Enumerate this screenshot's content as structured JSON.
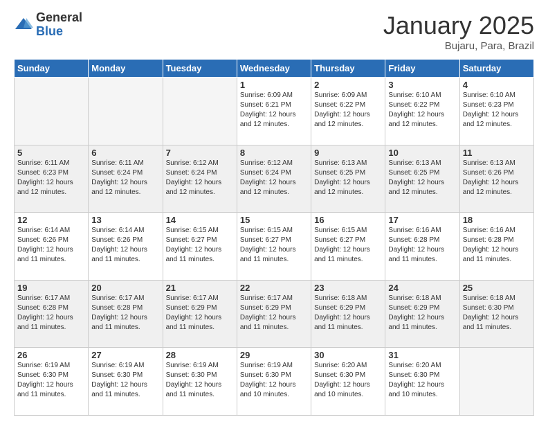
{
  "logo": {
    "general": "General",
    "blue": "Blue"
  },
  "title": "January 2025",
  "subtitle": "Bujaru, Para, Brazil",
  "days_of_week": [
    "Sunday",
    "Monday",
    "Tuesday",
    "Wednesday",
    "Thursday",
    "Friday",
    "Saturday"
  ],
  "weeks": [
    [
      {
        "day": "",
        "info": ""
      },
      {
        "day": "",
        "info": ""
      },
      {
        "day": "",
        "info": ""
      },
      {
        "day": "1",
        "info": "Sunrise: 6:09 AM\nSunset: 6:21 PM\nDaylight: 12 hours\nand 12 minutes."
      },
      {
        "day": "2",
        "info": "Sunrise: 6:09 AM\nSunset: 6:22 PM\nDaylight: 12 hours\nand 12 minutes."
      },
      {
        "day": "3",
        "info": "Sunrise: 6:10 AM\nSunset: 6:22 PM\nDaylight: 12 hours\nand 12 minutes."
      },
      {
        "day": "4",
        "info": "Sunrise: 6:10 AM\nSunset: 6:23 PM\nDaylight: 12 hours\nand 12 minutes."
      }
    ],
    [
      {
        "day": "5",
        "info": "Sunrise: 6:11 AM\nSunset: 6:23 PM\nDaylight: 12 hours\nand 12 minutes."
      },
      {
        "day": "6",
        "info": "Sunrise: 6:11 AM\nSunset: 6:24 PM\nDaylight: 12 hours\nand 12 minutes."
      },
      {
        "day": "7",
        "info": "Sunrise: 6:12 AM\nSunset: 6:24 PM\nDaylight: 12 hours\nand 12 minutes."
      },
      {
        "day": "8",
        "info": "Sunrise: 6:12 AM\nSunset: 6:24 PM\nDaylight: 12 hours\nand 12 minutes."
      },
      {
        "day": "9",
        "info": "Sunrise: 6:13 AM\nSunset: 6:25 PM\nDaylight: 12 hours\nand 12 minutes."
      },
      {
        "day": "10",
        "info": "Sunrise: 6:13 AM\nSunset: 6:25 PM\nDaylight: 12 hours\nand 12 minutes."
      },
      {
        "day": "11",
        "info": "Sunrise: 6:13 AM\nSunset: 6:26 PM\nDaylight: 12 hours\nand 12 minutes."
      }
    ],
    [
      {
        "day": "12",
        "info": "Sunrise: 6:14 AM\nSunset: 6:26 PM\nDaylight: 12 hours\nand 11 minutes."
      },
      {
        "day": "13",
        "info": "Sunrise: 6:14 AM\nSunset: 6:26 PM\nDaylight: 12 hours\nand 11 minutes."
      },
      {
        "day": "14",
        "info": "Sunrise: 6:15 AM\nSunset: 6:27 PM\nDaylight: 12 hours\nand 11 minutes."
      },
      {
        "day": "15",
        "info": "Sunrise: 6:15 AM\nSunset: 6:27 PM\nDaylight: 12 hours\nand 11 minutes."
      },
      {
        "day": "16",
        "info": "Sunrise: 6:15 AM\nSunset: 6:27 PM\nDaylight: 12 hours\nand 11 minutes."
      },
      {
        "day": "17",
        "info": "Sunrise: 6:16 AM\nSunset: 6:28 PM\nDaylight: 12 hours\nand 11 minutes."
      },
      {
        "day": "18",
        "info": "Sunrise: 6:16 AM\nSunset: 6:28 PM\nDaylight: 12 hours\nand 11 minutes."
      }
    ],
    [
      {
        "day": "19",
        "info": "Sunrise: 6:17 AM\nSunset: 6:28 PM\nDaylight: 12 hours\nand 11 minutes."
      },
      {
        "day": "20",
        "info": "Sunrise: 6:17 AM\nSunset: 6:28 PM\nDaylight: 12 hours\nand 11 minutes."
      },
      {
        "day": "21",
        "info": "Sunrise: 6:17 AM\nSunset: 6:29 PM\nDaylight: 12 hours\nand 11 minutes."
      },
      {
        "day": "22",
        "info": "Sunrise: 6:17 AM\nSunset: 6:29 PM\nDaylight: 12 hours\nand 11 minutes."
      },
      {
        "day": "23",
        "info": "Sunrise: 6:18 AM\nSunset: 6:29 PM\nDaylight: 12 hours\nand 11 minutes."
      },
      {
        "day": "24",
        "info": "Sunrise: 6:18 AM\nSunset: 6:29 PM\nDaylight: 12 hours\nand 11 minutes."
      },
      {
        "day": "25",
        "info": "Sunrise: 6:18 AM\nSunset: 6:30 PM\nDaylight: 12 hours\nand 11 minutes."
      }
    ],
    [
      {
        "day": "26",
        "info": "Sunrise: 6:19 AM\nSunset: 6:30 PM\nDaylight: 12 hours\nand 11 minutes."
      },
      {
        "day": "27",
        "info": "Sunrise: 6:19 AM\nSunset: 6:30 PM\nDaylight: 12 hours\nand 11 minutes."
      },
      {
        "day": "28",
        "info": "Sunrise: 6:19 AM\nSunset: 6:30 PM\nDaylight: 12 hours\nand 11 minutes."
      },
      {
        "day": "29",
        "info": "Sunrise: 6:19 AM\nSunset: 6:30 PM\nDaylight: 12 hours\nand 10 minutes."
      },
      {
        "day": "30",
        "info": "Sunrise: 6:20 AM\nSunset: 6:30 PM\nDaylight: 12 hours\nand 10 minutes."
      },
      {
        "day": "31",
        "info": "Sunrise: 6:20 AM\nSunset: 6:30 PM\nDaylight: 12 hours\nand 10 minutes."
      },
      {
        "day": "",
        "info": ""
      }
    ]
  ]
}
